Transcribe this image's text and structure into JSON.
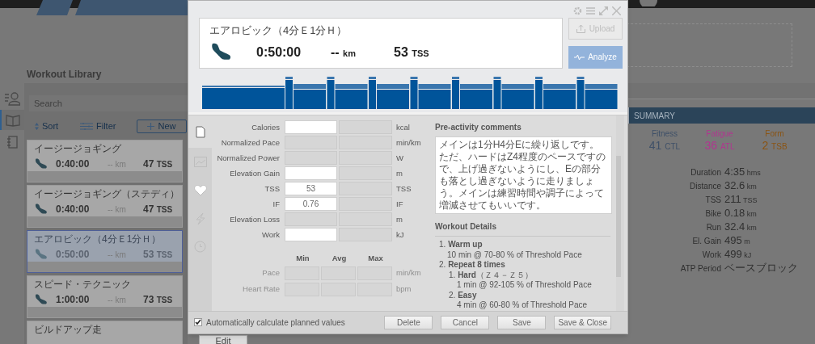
{
  "library": {
    "title": "Workout Library",
    "search": {
      "placeholder": "Search"
    },
    "sort": "Sort",
    "filter": "Filter",
    "new_button": "New",
    "nav": [
      {
        "kind": "athletes",
        "selected": false
      },
      {
        "kind": "library",
        "selected": true
      },
      {
        "kind": "plans",
        "selected": false
      }
    ],
    "workouts": [
      {
        "title": "イージージョギング",
        "duration": "0:40:00",
        "distance": "--",
        "distance_unit": "km",
        "tss": "47",
        "tss_unit": "TSS",
        "selected": false
      },
      {
        "title": "イージージョギング（ステディ）",
        "duration": "0:40:00",
        "distance": "--",
        "distance_unit": "km",
        "tss": "47",
        "tss_unit": "TSS",
        "selected": false
      },
      {
        "title": "エアロビック（4分Ｅ1分Ｈ）",
        "duration": "0:50:00",
        "distance": "--",
        "distance_unit": "km",
        "tss": "53",
        "tss_unit": "TSS",
        "selected": true
      },
      {
        "title": "スピード・テクニック",
        "duration": "1:00:00",
        "distance": "--",
        "distance_unit": "km",
        "tss": "73",
        "tss_unit": "TSS",
        "selected": false
      },
      {
        "title": "ビルドアップ走",
        "selected": false
      }
    ]
  },
  "calendar": {
    "edit_button": "Edit"
  },
  "summary": {
    "title": "SUMMARY",
    "scores": [
      {
        "label": "Fitness",
        "value": "41",
        "unit": "CTL",
        "color": "#3f5068"
      },
      {
        "label": "Fatigue",
        "value": "36",
        "unit": "ATL",
        "color": "#b0368f"
      },
      {
        "label": "Form",
        "value": "2",
        "unit": "TSB",
        "color": "#8a5414"
      }
    ],
    "stats": [
      {
        "label": "Duration",
        "value": "4:35",
        "unit": "hms"
      },
      {
        "label": "Distance",
        "value": "32.6",
        "unit": "km"
      },
      {
        "label": "TSS",
        "value": "211",
        "unit": "TSS"
      },
      {
        "label": "Bike",
        "value": "0.18",
        "unit": "km"
      },
      {
        "label": "Run",
        "value": "32.4",
        "unit": "km"
      },
      {
        "label": "El. Gain",
        "value": "495",
        "unit": "m"
      },
      {
        "label": "Work",
        "value": "499",
        "unit": "kJ"
      },
      {
        "label": "ATP Period",
        "value": "ベースブロック"
      }
    ]
  },
  "dialog": {
    "title": "エアロビック（4分Ｅ1分Ｈ）",
    "duration": "0:50:00",
    "distance": "--",
    "distance_unit": "km",
    "tss": "53",
    "tss_unit": "TSS",
    "upload": {
      "label": "Upload",
      "disabled": true
    },
    "analyze": "Analyze",
    "tabs": [
      {
        "kind": "details",
        "selected": true
      },
      {
        "kind": "chart",
        "selected": false
      },
      {
        "kind": "heart",
        "selected": false
      },
      {
        "kind": "power",
        "selected": false
      },
      {
        "kind": "time",
        "selected": false
      }
    ],
    "metrics": [
      {
        "label": "Calories",
        "editable": true,
        "unit": "kcal"
      },
      {
        "label": "Normalized Pace",
        "editable": false,
        "unit": "min/km"
      },
      {
        "label": "Normalized Power",
        "editable": false,
        "unit": "W"
      },
      {
        "label": "Elevation Gain",
        "editable": true,
        "unit": "m"
      },
      {
        "label": "TSS",
        "editable": true,
        "planned": "53",
        "unit": "TSS"
      },
      {
        "label": "IF",
        "editable": true,
        "planned": "0.76",
        "unit": "IF"
      },
      {
        "label": "Elevation Loss",
        "editable": false,
        "unit": "m"
      },
      {
        "label": "Work",
        "editable": true,
        "unit": "kJ"
      }
    ],
    "range": {
      "columns": [
        "Min",
        "Avg",
        "Max"
      ],
      "rows": [
        {
          "label": "Pace",
          "unit": "min/km",
          "disabled": true
        },
        {
          "label": "Heart Rate",
          "unit": "bpm",
          "disabled": true
        }
      ]
    },
    "comments": {
      "title": "Pre-activity comments",
      "text": "メインは1分H4分Eに繰り返しです。ただ、ハードはZ4程度のペースですので、上げ過ぎないようにし、Eの部分も落とし過ぎないように走りましょう。メインは練習時間や調子によって増減させてもいいです。"
    },
    "details": {
      "title": "Workout Details",
      "steps": [
        {
          "number": "1.",
          "title": "Warm up",
          "detail": "10 min @ 70-80 % of Threshold Pace"
        },
        {
          "number": "2.",
          "title": "Repeat 8 times",
          "children": [
            {
              "number": "1.",
              "title": "Hard",
              "note": "（Ｚ４－Ｚ５）",
              "detail": "1 min @ 92-105 % of Threshold Pace"
            },
            {
              "number": "2.",
              "title": "Easy",
              "detail": "4 min @ 60-80 % of Threshold Pace"
            }
          ]
        }
      ]
    },
    "auto_calculate": {
      "label": "Automatically calculate planned values",
      "checked": true
    },
    "buttons": [
      "Delete",
      "Cancel",
      "Save",
      "Save & Close"
    ]
  }
}
